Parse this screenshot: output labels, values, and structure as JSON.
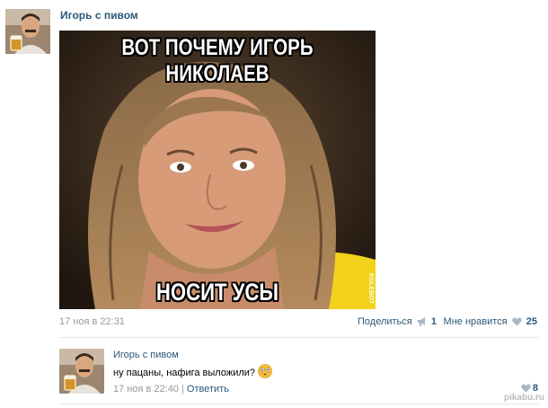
{
  "post": {
    "author": "Игорь с пивом",
    "meme_top_text": "ВОТ ПОЧЕМУ ИГОРЬ НИКОЛАЕВ",
    "meme_bottom_text": "НОСИТ УСЫ",
    "watermark": "KOLEBOT",
    "date": "17 ноя в 22:31",
    "share_label": "Поделиться",
    "share_count": "1",
    "like_label": "Мне нравится",
    "like_count": "25"
  },
  "comment": {
    "author": "Игорь с пивом",
    "text": "ну пацаны, нафига выложили?",
    "date": "17 ноя в 22:40",
    "separator": " | ",
    "reply_label": "Ответить",
    "like_count": "8"
  },
  "site_watermark": "pikabu.ru",
  "colors": {
    "link": "#2b587a",
    "muted": "#999999",
    "divider": "#e7e8ec",
    "heart": "#a9b8c8"
  },
  "icons": {
    "share": "megaphone-icon",
    "like": "heart-icon",
    "emoji": "flushed-face-icon"
  }
}
